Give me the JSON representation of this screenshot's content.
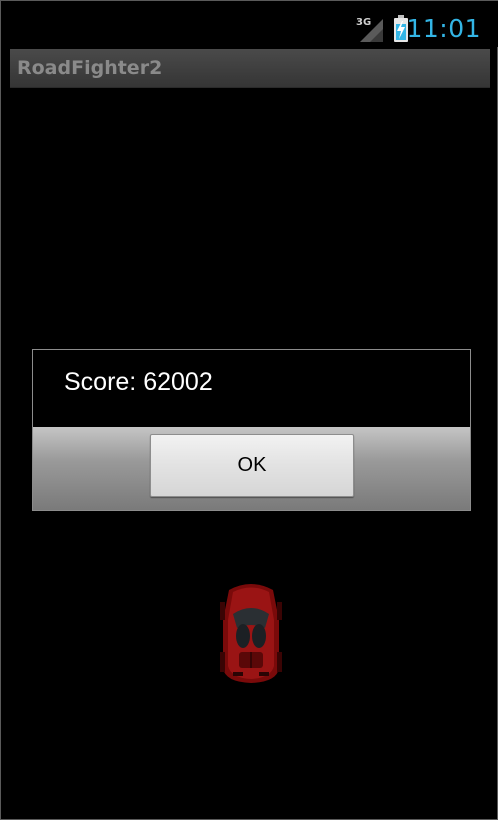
{
  "status_bar": {
    "network_type": "3G",
    "time": "11:01",
    "clock_color": "#33b5e5",
    "icons": [
      "signal-3g-icon",
      "battery-charging-icon"
    ]
  },
  "app": {
    "title": "RoadFighter2"
  },
  "dialog": {
    "message": "Score: 62002",
    "ok_label": "OK"
  },
  "game": {
    "player_car": "red-sports-car"
  }
}
